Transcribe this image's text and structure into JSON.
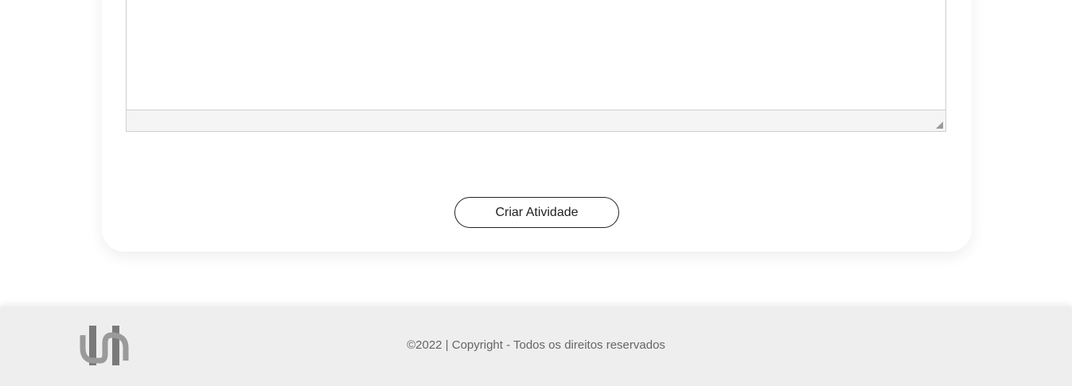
{
  "form": {
    "submit_label": "Criar Atividade"
  },
  "footer": {
    "copyright": "©2022 | Copyright - Todos os direitos reservados",
    "logo_icon": "brand-logo-icon"
  },
  "colors": {
    "footer_bg": "#eeeeee",
    "logo": "#7a7a7a",
    "button_border": "#222222",
    "text_muted": "#666666"
  }
}
